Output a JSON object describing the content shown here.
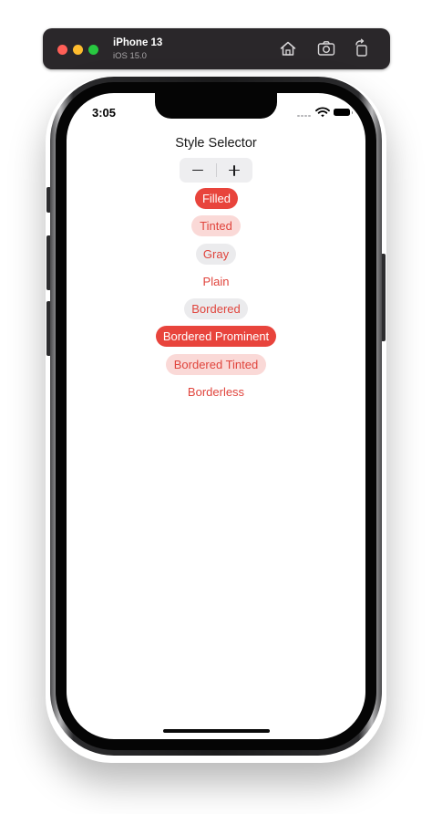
{
  "simulator": {
    "device_name": "iPhone 13",
    "os_version": "iOS 15.0",
    "toolbar": {
      "home_icon": "home-icon",
      "screenshot_icon": "camera-icon",
      "rotate_icon": "rotate-icon"
    },
    "window_controls": [
      "close",
      "minimize",
      "zoom"
    ]
  },
  "status_bar": {
    "time": "3:05",
    "icons": [
      "cellular-signal-icon",
      "wifi-icon",
      "battery-icon"
    ]
  },
  "app": {
    "title": "Style Selector",
    "stepper": {
      "decrement_icon": "minus-icon",
      "increment_icon": "plus-icon"
    },
    "button_styles": [
      {
        "label": "Filled",
        "style": "filled"
      },
      {
        "label": "Tinted",
        "style": "tinted"
      },
      {
        "label": "Gray",
        "style": "gray"
      },
      {
        "label": "Plain",
        "style": "plain"
      },
      {
        "label": "Bordered",
        "style": "bordered"
      },
      {
        "label": "Bordered Prominent",
        "style": "bordered-prominent"
      },
      {
        "label": "Bordered Tinted",
        "style": "bordered-tinted"
      },
      {
        "label": "Borderless",
        "style": "borderless"
      }
    ]
  },
  "colors": {
    "accent": "#e8443c",
    "tint_background": "#fad9d7",
    "gray_background": "#ebebed"
  }
}
